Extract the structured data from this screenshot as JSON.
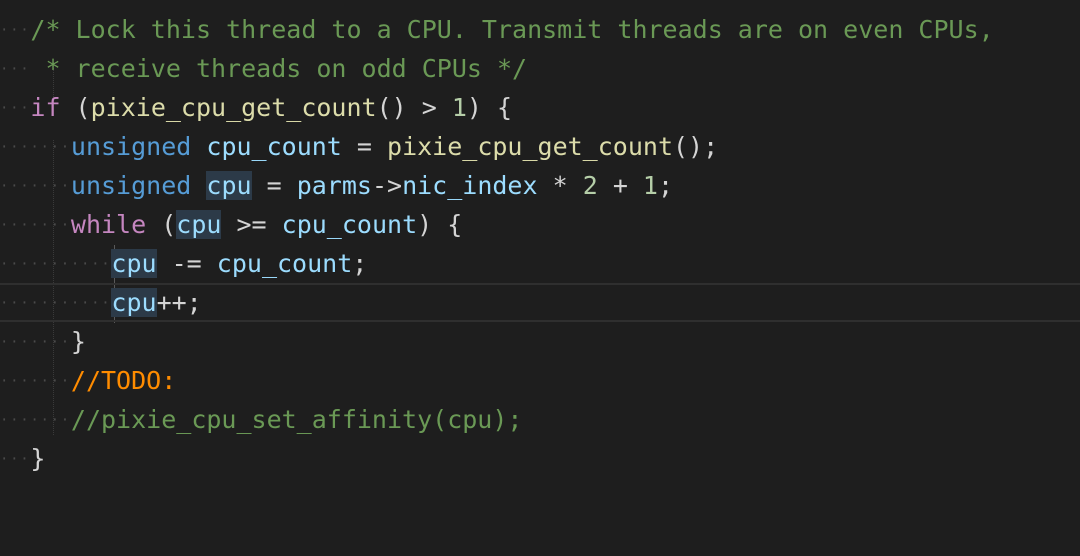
{
  "colors": {
    "background": "#1e1e1e",
    "comment": "#6a9955",
    "keyword": "#c586c0",
    "type": "#569cd6",
    "variable": "#9cdcfe",
    "function": "#dcdcaa",
    "number": "#b5cea8",
    "todo": "#ff8c00",
    "highlight": "#2c3a48"
  },
  "code": {
    "line1": {
      "comment": "/* Lock this thread to a CPU. Transmit threads are on even CPUs,"
    },
    "line2": {
      "comment": " * receive threads on odd CPUs */"
    },
    "line3": {
      "kw": "if",
      "t1": " (",
      "fn": "pixie_cpu_get_count",
      "t2": "() > ",
      "num": "1",
      "t3": ") {"
    },
    "line4": {
      "type": "unsigned",
      "t1": " ",
      "var": "cpu_count",
      "t2": " = ",
      "fn": "pixie_cpu_get_count",
      "t3": "();"
    },
    "line5": {
      "type": "unsigned",
      "t1": " ",
      "var": "cpu",
      "t2": " = ",
      "var2": "parms",
      "t3": "->",
      "var3": "nic_index",
      "t4": " * ",
      "num1": "2",
      "t5": " + ",
      "num2": "1",
      "t6": ";"
    },
    "line6": {
      "kw": "while",
      "t1": " (",
      "var": "cpu",
      "t2": " >= ",
      "var2": "cpu_count",
      "t3": ") {"
    },
    "line7": {
      "var": "cpu",
      "t1": " -= ",
      "var2": "cpu_count",
      "t2": ";"
    },
    "line8": {
      "var": "cpu",
      "t1": "++;"
    },
    "line9": {
      "t1": "}"
    },
    "line10": {
      "comment": "//TODO:"
    },
    "line11": {
      "comment": "//pixie_cpu_set_affinity(cpu);"
    },
    "line12": {
      "t1": "}"
    }
  }
}
